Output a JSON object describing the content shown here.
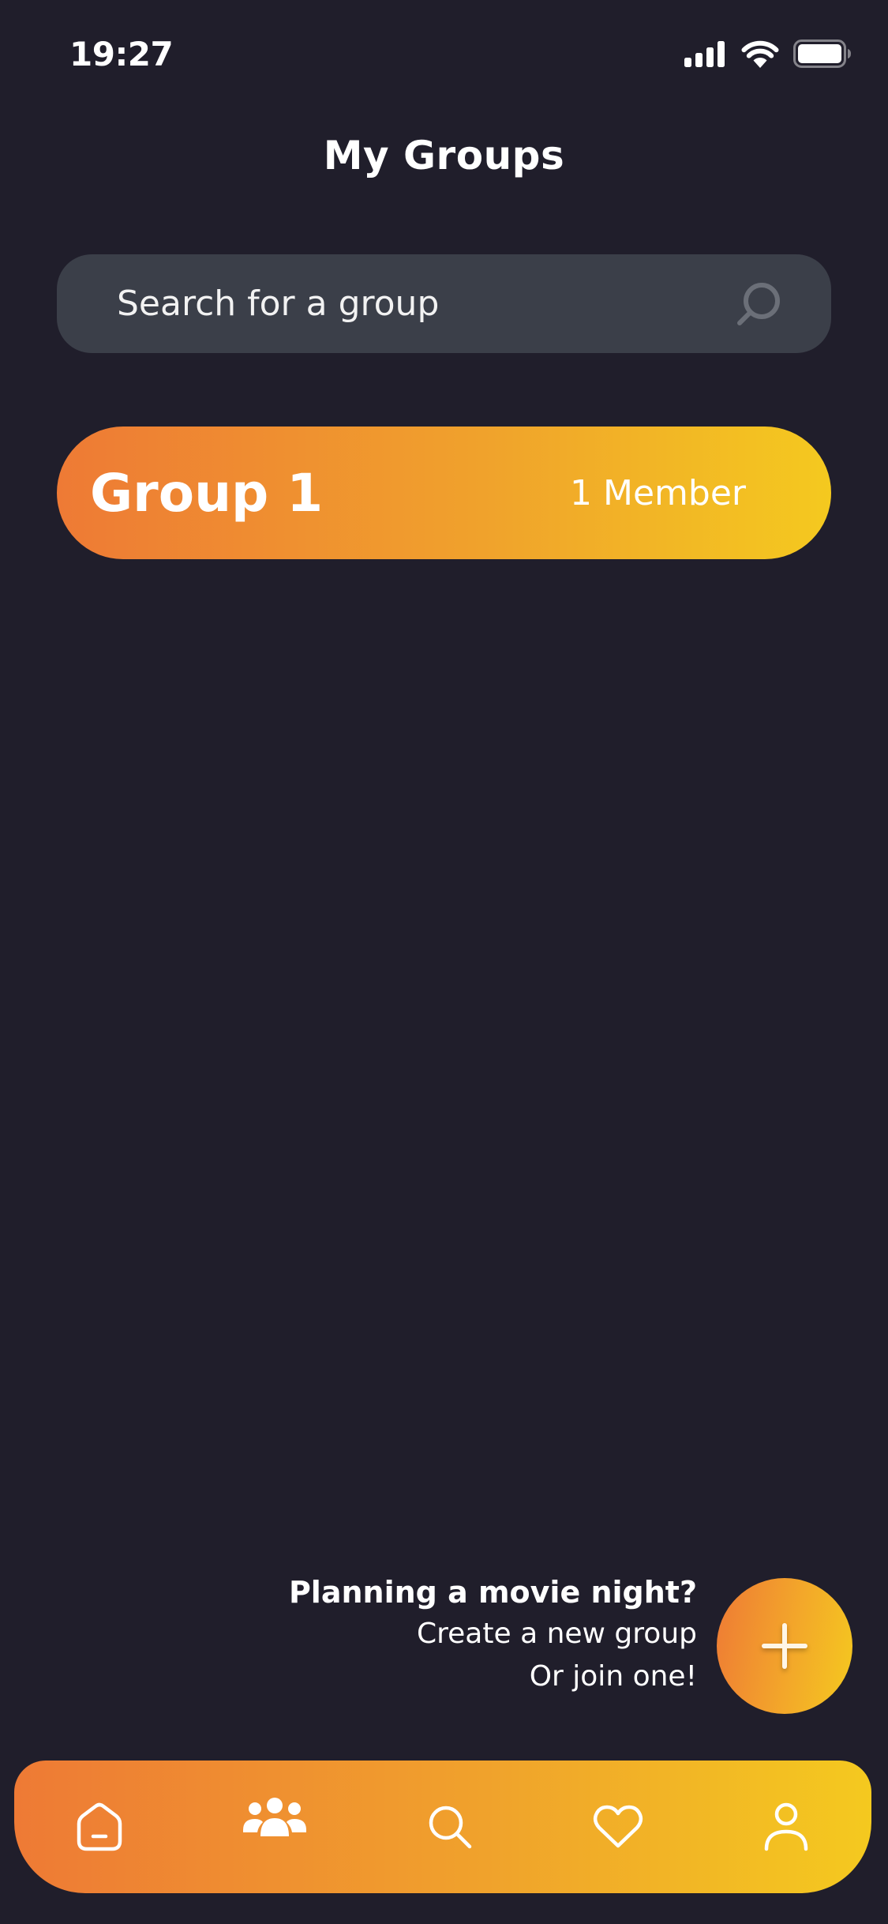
{
  "status_bar": {
    "time": "19:27",
    "icons": [
      "cellular-signal-icon",
      "wifi-icon",
      "battery-icon"
    ]
  },
  "header": {
    "title": "My Groups"
  },
  "search": {
    "placeholder": "Search for a group",
    "value": "",
    "icon": "search-icon"
  },
  "groups": [
    {
      "name": "Group 1",
      "members": "1 Member"
    }
  ],
  "prompt": {
    "title": "Planning a movie night?",
    "line1": "Create a new group",
    "line2": "Or join one!"
  },
  "fab": {
    "icon": "plus-icon"
  },
  "bottom_nav": {
    "items": [
      {
        "id": "home",
        "icon": "home-icon"
      },
      {
        "id": "groups",
        "icon": "groups-icon",
        "active": true
      },
      {
        "id": "search",
        "icon": "search-icon"
      },
      {
        "id": "favorites",
        "icon": "heart-icon"
      },
      {
        "id": "profile",
        "icon": "user-icon"
      }
    ]
  },
  "colors": {
    "background": "#201e2b",
    "search_field": "#3b3f49",
    "gradient_start": "#ee7a35",
    "gradient_end": "#f4c91f",
    "text": "#ffffff"
  }
}
